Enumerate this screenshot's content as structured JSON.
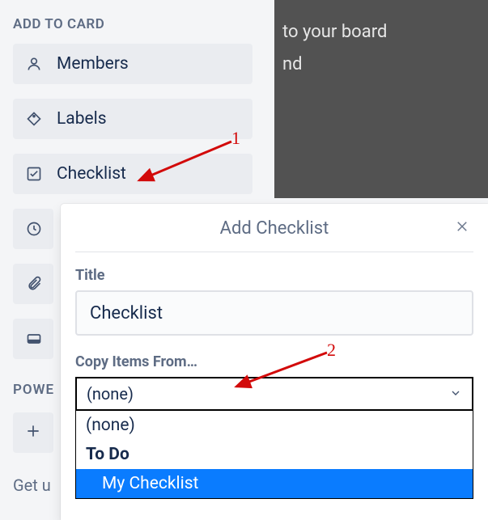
{
  "overlay": {
    "line1": "to your board",
    "line2": "nd"
  },
  "sidebar": {
    "heading": "ADD TO CARD",
    "items": [
      {
        "label": "Members",
        "icon": "person-icon"
      },
      {
        "label": "Labels",
        "icon": "tag-icon"
      },
      {
        "label": "Checklist",
        "icon": "check-square-icon"
      },
      {
        "label": "",
        "icon": "clock-icon"
      },
      {
        "label": "",
        "icon": "attachment-icon"
      },
      {
        "label": "",
        "icon": "card-icon"
      }
    ],
    "power_heading": "POWE",
    "footer": "Get u"
  },
  "popup": {
    "title": "Add Checklist",
    "fields": {
      "title_label": "Title",
      "title_value": "Checklist",
      "copy_label": "Copy Items From…",
      "copy_selected": "(none)"
    },
    "dropdown_options": [
      {
        "label": "(none)",
        "bold": false,
        "highlighted": false
      },
      {
        "label": "To Do",
        "bold": true,
        "highlighted": false
      },
      {
        "label": "My Checklist",
        "bold": false,
        "highlighted": true
      }
    ]
  },
  "annotations": {
    "one": "1",
    "two": "2"
  }
}
